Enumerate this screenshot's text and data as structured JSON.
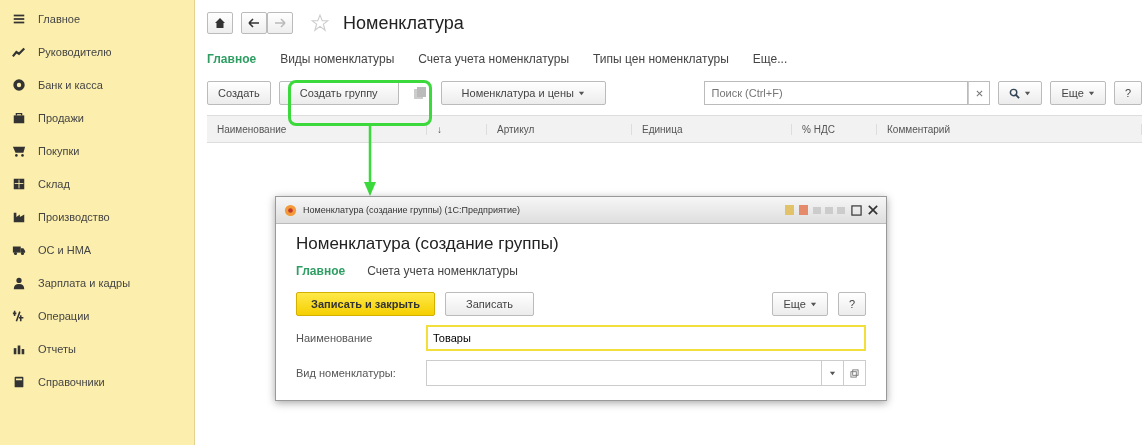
{
  "sidebar": {
    "items": [
      {
        "label": "Главное"
      },
      {
        "label": "Руководителю"
      },
      {
        "label": "Банк и касса"
      },
      {
        "label": "Продажи"
      },
      {
        "label": "Покупки"
      },
      {
        "label": "Склад"
      },
      {
        "label": "Производство"
      },
      {
        "label": "ОС и НМА"
      },
      {
        "label": "Зарплата и кадры"
      },
      {
        "label": "Операции"
      },
      {
        "label": "Отчеты"
      },
      {
        "label": "Справочники"
      }
    ]
  },
  "page": {
    "title": "Номенклатура",
    "tabs": [
      {
        "label": "Главное",
        "selected": true
      },
      {
        "label": "Виды номенклатуры",
        "selected": false
      },
      {
        "label": "Счета учета номенклатуры",
        "selected": false
      },
      {
        "label": "Типы цен номенклатуры",
        "selected": false
      },
      {
        "label": "Еще...",
        "selected": false
      }
    ],
    "toolbar": {
      "create": "Создать",
      "create_group": "Создать группу",
      "prices": "Номенклатура и цены",
      "search_placeholder": "Поиск (Ctrl+F)",
      "more": "Еще",
      "help": "?"
    },
    "table": {
      "columns": [
        "Наименование",
        "↓",
        "Артикул",
        "Единица",
        "% НДС",
        "Комментарий"
      ]
    }
  },
  "dialog": {
    "window_title": "Номенклатура (создание группы) (1С:Предприятие)",
    "title": "Номенклатура (создание группы)",
    "tabs": [
      {
        "label": "Главное",
        "selected": true
      },
      {
        "label": "Счета учета номенклатуры",
        "selected": false
      }
    ],
    "save_close": "Записать и закрыть",
    "save": "Записать",
    "more": "Еще",
    "help": "?",
    "fields": [
      {
        "label": "Наименование",
        "value": "Товары",
        "focused": true,
        "kind": "text"
      },
      {
        "label": "Вид номенклатуры:",
        "focused": false,
        "kind": "select"
      }
    ]
  }
}
